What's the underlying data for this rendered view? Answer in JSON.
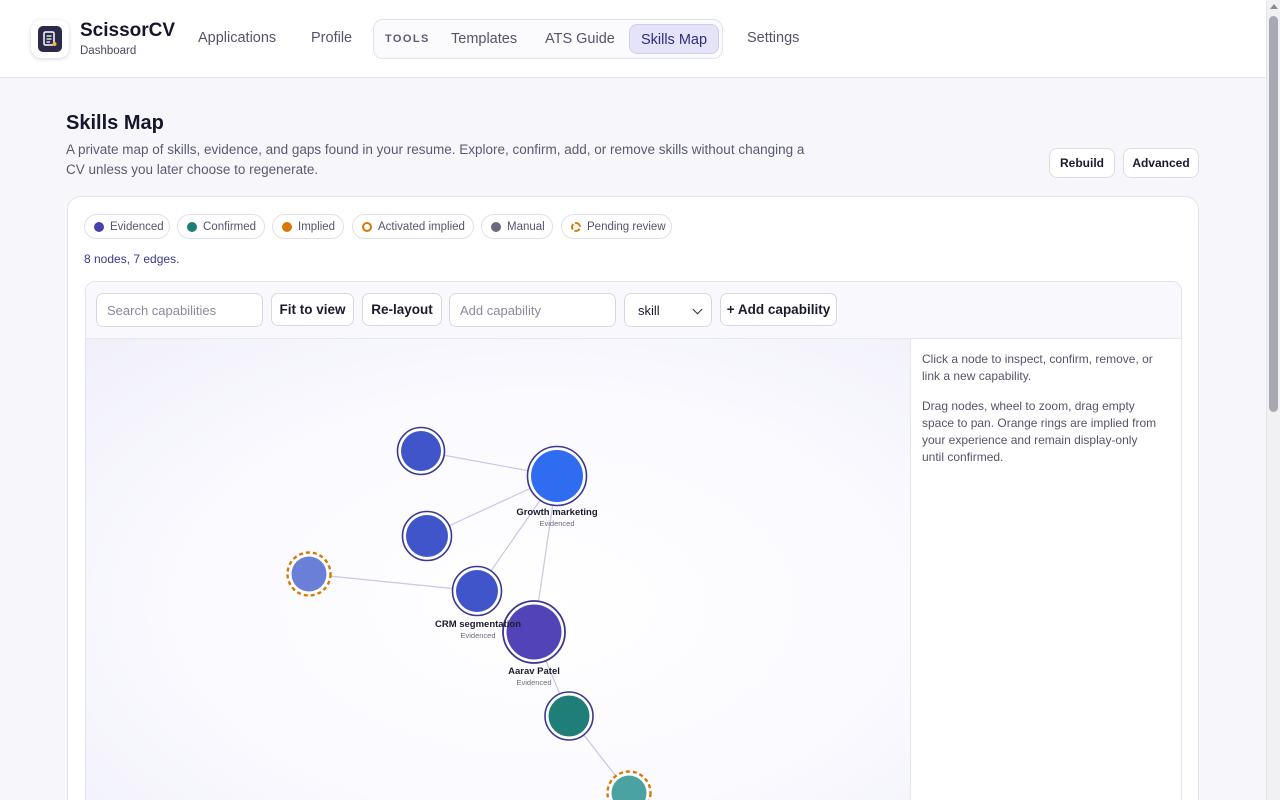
{
  "app": {
    "name": "ScissorCV",
    "subtitle": "Dashboard",
    "logo_icon": "document-icon"
  },
  "nav": {
    "applications": "Applications",
    "profile": "Profile",
    "tools_label": "TOOLS",
    "templates": "Templates",
    "ats_guide": "ATS Guide",
    "skills_map": "Skills Map",
    "settings": "Settings",
    "active": "Skills Map"
  },
  "page": {
    "title": "Skills Map",
    "description": "A private map of skills, evidence, and gaps found in your resume. Explore, confirm, add, or remove skills without changing a CV unless you later choose to regenerate.",
    "rebuild_label": "Rebuild",
    "advanced_label": "Advanced"
  },
  "legend": [
    {
      "label": "Evidenced",
      "color": "#4a3fb0",
      "style": "filled"
    },
    {
      "label": "Confirmed",
      "color": "#1f7f78",
      "style": "filled"
    },
    {
      "label": "Implied",
      "color": "#d97706",
      "style": "filled"
    },
    {
      "label": "Activated implied",
      "color": "#d97706",
      "style": "ring"
    },
    {
      "label": "Manual",
      "color": "#6b6b80",
      "style": "filled"
    },
    {
      "label": "Pending review",
      "color": "#d97706",
      "style": "dashed-ring"
    }
  ],
  "stats": "8 nodes, 7 edges.",
  "toolbar": {
    "search_placeholder": "Search capabilities",
    "fit_label": "Fit to view",
    "relayout_label": "Re-layout",
    "add_placeholder": "Add capability",
    "type_value": "skill",
    "add_button_label": "+ Add capability"
  },
  "graph": {
    "nodes": [
      {
        "id": "n1",
        "label": "",
        "status": "",
        "fill": "#3f55c9",
        "ring": "#3a3891",
        "dashed": false
      },
      {
        "id": "n2",
        "label": "Growth marketing",
        "status": "Evidenced",
        "fill": "#2f6cf0",
        "ring": "#3a3891",
        "dashed": false
      },
      {
        "id": "n3",
        "label": "",
        "status": "",
        "fill": "#3f55c9",
        "ring": "#3a3891",
        "dashed": false
      },
      {
        "id": "n4",
        "label": "",
        "status": "",
        "fill": "#6a80d8",
        "ring": "#d97706",
        "dashed": true
      },
      {
        "id": "n5",
        "label": "CRM segmentation",
        "status": "Evidenced",
        "fill": "#3f55c9",
        "ring": "#3a3891",
        "dashed": false
      },
      {
        "id": "n6",
        "label": "Aarav Patel",
        "status": "Evidenced",
        "fill": "#5244b8",
        "ring": "#3a3891",
        "dashed": false
      },
      {
        "id": "n7",
        "label": "",
        "status": "",
        "fill": "#1f7f78",
        "ring": "#3a3891",
        "dashed": false
      },
      {
        "id": "n8",
        "label": "",
        "status": "",
        "fill": "#4aa3a0",
        "ring": "#d97706",
        "dashed": true
      }
    ],
    "edges": [
      [
        "n1",
        "n2"
      ],
      [
        "n2",
        "n3"
      ],
      [
        "n2",
        "n5"
      ],
      [
        "n2",
        "n6"
      ],
      [
        "n4",
        "n5"
      ],
      [
        "n6",
        "n7"
      ],
      [
        "n7",
        "n8"
      ]
    ]
  },
  "side_panel": {
    "hint_1": "Click a node to inspect, confirm, remove, or link a new capability.",
    "hint_2": "Drag nodes, wheel to zoom, drag empty space to pan. Orange rings are implied from your experience and remain display-only until confirmed."
  }
}
